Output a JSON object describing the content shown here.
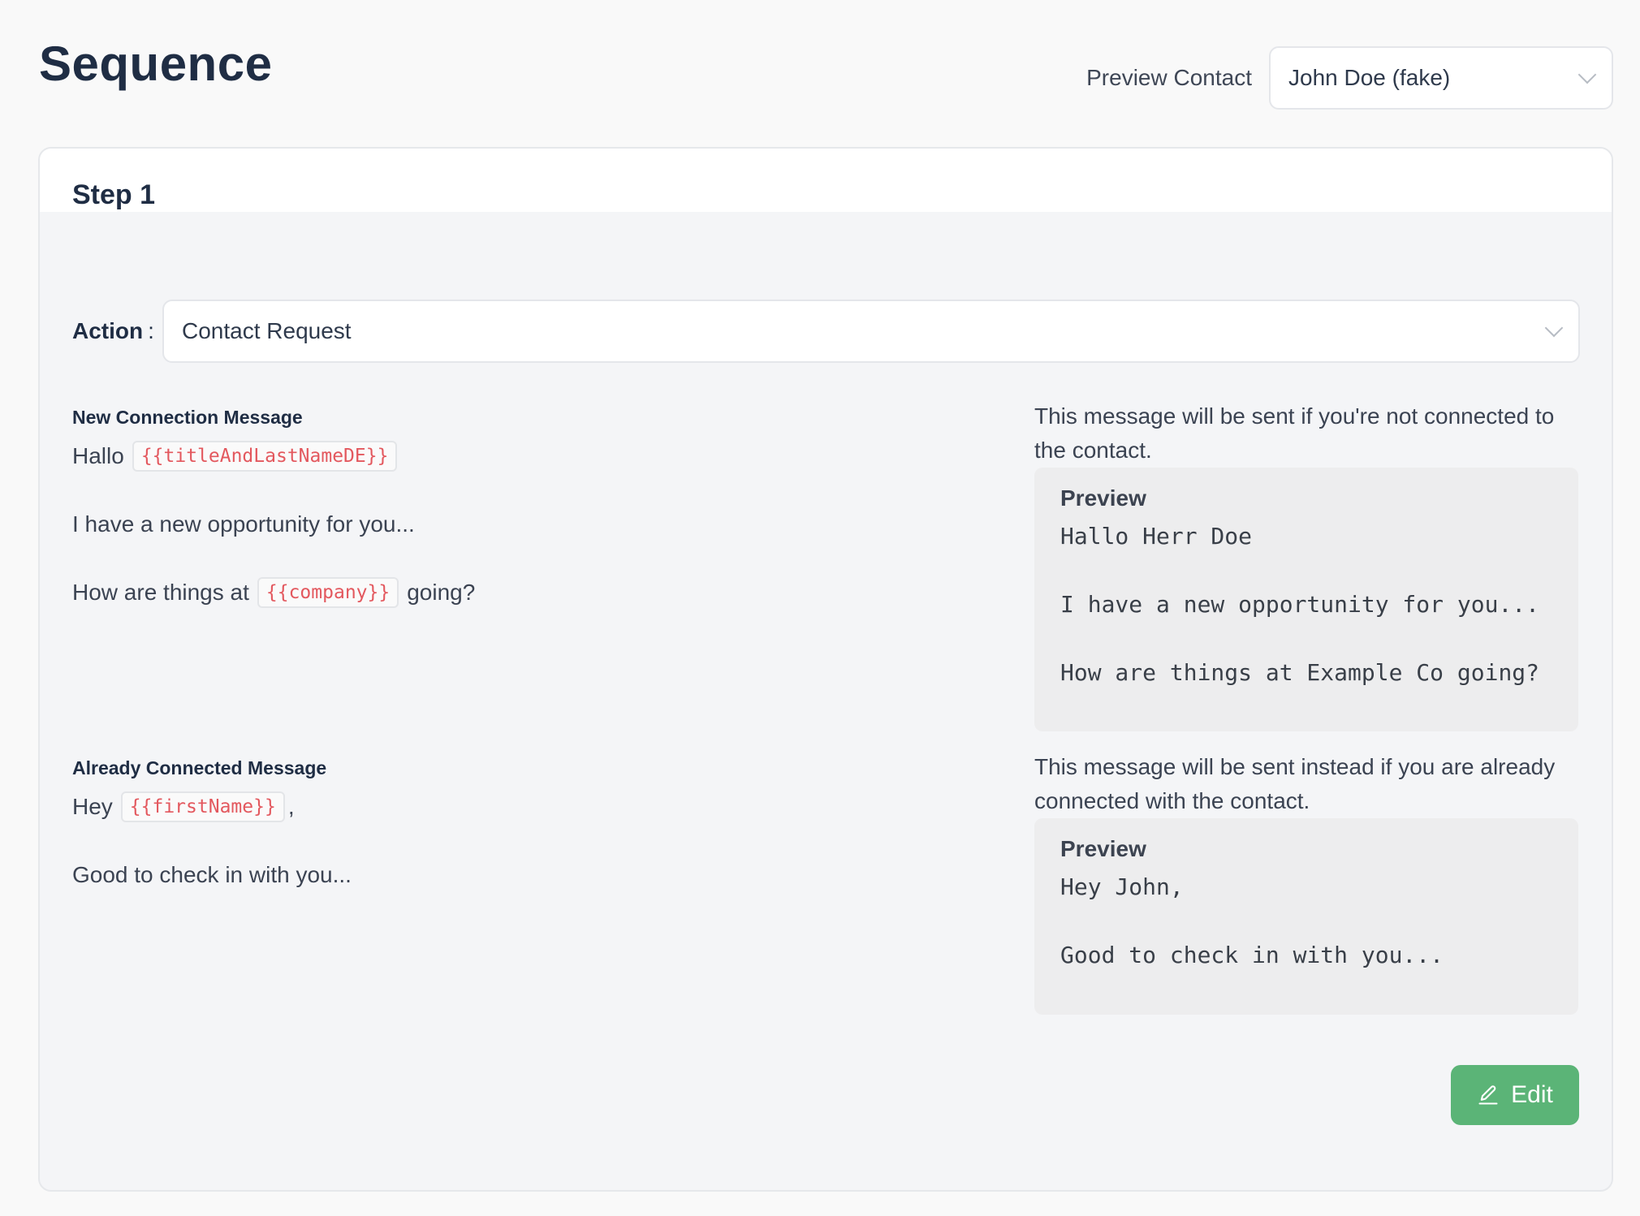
{
  "page": {
    "title": "Sequence"
  },
  "preview_contact": {
    "label": "Preview Contact",
    "selected": "John Doe (fake)"
  },
  "step": {
    "title": "Step 1",
    "action_label": "Action",
    "action_colon": ":",
    "action_selected": "Contact Request",
    "new_connection": {
      "heading": "New Connection Message",
      "line1_text": "Hallo",
      "line1_token": "{{titleAndLastNameDE}}",
      "line2": "I have a new opportunity for you...",
      "line3_before": "How are things at",
      "line3_token": "{{company}}",
      "line3_after": "going?",
      "note": "This message will be sent if you're not connected to the contact.",
      "preview_label": "Preview",
      "preview_lines": [
        "Hallo Herr Doe",
        "",
        "I have a new opportunity for you...",
        "",
        "How are things at Example Co going?"
      ]
    },
    "already_connected": {
      "heading": "Already Connected Message",
      "line1_text": "Hey",
      "line1_token": "{{firstName}}",
      "line1_after": ",",
      "line2": "Good to check in with you...",
      "note": "This message will be sent instead if you are already connected with the contact.",
      "preview_label": "Preview",
      "preview_lines": [
        "Hey John,",
        "",
        "Good to check in with you..."
      ]
    },
    "edit_label": "Edit"
  },
  "colors": {
    "accent_green": "#5bb477",
    "token_red": "#e3585e",
    "heading": "#1f2d44"
  },
  "icons": {
    "edit": "pencil-icon",
    "dropdown": "chevron-down-icon"
  }
}
